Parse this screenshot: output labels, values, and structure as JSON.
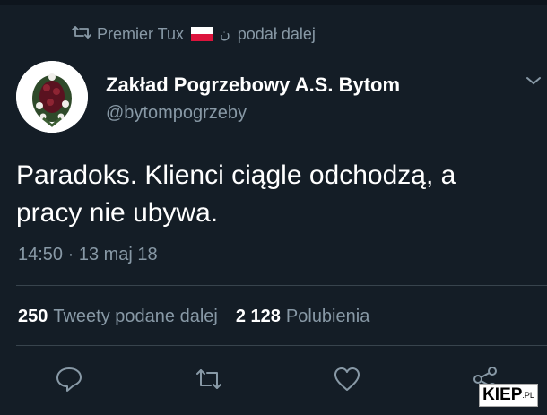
{
  "retweet": {
    "user": "Premier Tux",
    "label": "podał dalej"
  },
  "author": {
    "name": "Zakład Pogrzebowy A.S. Bytom",
    "handle": "@bytompogrzeby"
  },
  "tweet": {
    "line1": "Paradoks. Klienci ciągle odchodzą, a",
    "line2": "pracy nie ubywa.",
    "timestamp": "14:50 · 13 maj 18"
  },
  "stats": {
    "retweets": "250",
    "retweets_label": "Tweety podane dalej",
    "likes": "2 128",
    "likes_label": "Polubienia"
  },
  "actions": [
    "reply-icon",
    "retweet-icon",
    "like-icon",
    "share-icon"
  ],
  "watermark": {
    "main": "KIEP",
    "suffix": ".PL"
  },
  "colors": {
    "background": "#141d26",
    "secondary_text": "#8899a6",
    "divider": "#38444d",
    "flag_red": "#dc143c"
  }
}
